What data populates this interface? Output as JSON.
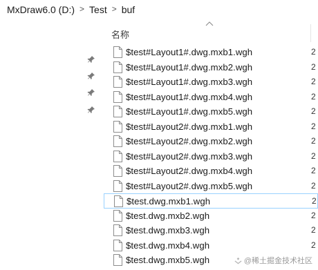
{
  "breadcrumb": {
    "items": [
      "MxDraw6.0 (D:)",
      "Test",
      "buf"
    ],
    "separator": ">"
  },
  "column_header": {
    "name_label": "名称"
  },
  "sidebar": {
    "pins": [
      "pin-icon",
      "pin-icon",
      "pin-icon",
      "pin-icon"
    ]
  },
  "files": [
    {
      "name": "$test#Layout1#.dwg.mxb1.wgh",
      "edge": "2"
    },
    {
      "name": "$test#Layout1#.dwg.mxb2.wgh",
      "edge": "2"
    },
    {
      "name": "$test#Layout1#.dwg.mxb3.wgh",
      "edge": "2"
    },
    {
      "name": "$test#Layout1#.dwg.mxb4.wgh",
      "edge": "2"
    },
    {
      "name": "$test#Layout1#.dwg.mxb5.wgh",
      "edge": "2"
    },
    {
      "name": "$test#Layout2#.dwg.mxb1.wgh",
      "edge": "2"
    },
    {
      "name": "$test#Layout2#.dwg.mxb2.wgh",
      "edge": "2"
    },
    {
      "name": "$test#Layout2#.dwg.mxb3.wgh",
      "edge": "2"
    },
    {
      "name": "$test#Layout2#.dwg.mxb4.wgh",
      "edge": "2"
    },
    {
      "name": "$test#Layout2#.dwg.mxb5.wgh",
      "edge": "2"
    },
    {
      "name": "$test.dwg.mxb1.wgh",
      "edge": "2",
      "selected": true
    },
    {
      "name": "$test.dwg.mxb2.wgh",
      "edge": "2"
    },
    {
      "name": "$test.dwg.mxb3.wgh",
      "edge": "2"
    },
    {
      "name": "$test.dwg.mxb4.wgh",
      "edge": "2"
    },
    {
      "name": "$test.dwg.mxb5.wgh",
      "edge": ""
    }
  ],
  "watermark": "@稀土掘金技术社区",
  "colors": {
    "selection_border": "#99d1ff",
    "text": "#1a1a1a"
  }
}
